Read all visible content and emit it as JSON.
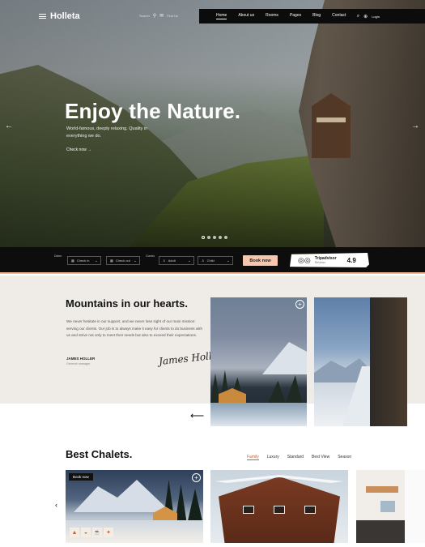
{
  "brand": {
    "name": "Holleta"
  },
  "topinfo": {
    "item1": "Search",
    "item2": "Find Us"
  },
  "nav": {
    "links": [
      "Home",
      "About us",
      "Rooms",
      "Pages",
      "Blog",
      "Contact"
    ],
    "active": "Home",
    "login": "Login"
  },
  "hero": {
    "title": "Enjoy the Nature.",
    "subtitle": "World-famous, deeply relaxing. Quality in everything we do.",
    "link": "Check now →",
    "slides": 5,
    "active_slide": 1
  },
  "booking": {
    "dates_label": "Dates",
    "guests_label": "Guests",
    "check_in": "Check in",
    "check_out": "Check out",
    "adult": "Adult",
    "child": "Child",
    "button": "Book now"
  },
  "tripadvisor": {
    "name": "Tripadvisor",
    "sub": "Reviews",
    "rating": "4.9"
  },
  "about": {
    "title": "Mountains in our hearts.",
    "text": "We never hesitate in our support, and we never lose sight of our main mission: serving our clients. Our job is to always make it easy for clients to do business with us and strive not only to meet their needs but also to exceed their expectations.",
    "signer_name": "JAMES HOLLER",
    "signer_role": "General manager",
    "signature": "James Holler"
  },
  "chalets": {
    "title": "Best Chalets.",
    "filters": [
      "Family",
      "Luxury",
      "Standard",
      "Best View",
      "Season"
    ],
    "active_filter": "Family",
    "book_tag": "Book now"
  },
  "icons": {
    "hamburger": "menu-icon",
    "location": "pin-icon",
    "mail": "mail-icon",
    "search": "search-icon",
    "user": "user-icon",
    "prev": "arrow-left-icon",
    "next": "arrow-right-icon",
    "plus": "plus-icon",
    "tripadvisor": "owl-icon"
  },
  "colors": {
    "accent": "#f6c7ac",
    "accent_text": "#c2643a",
    "dark": "#0d0d0d",
    "about_bg": "#efece7"
  }
}
